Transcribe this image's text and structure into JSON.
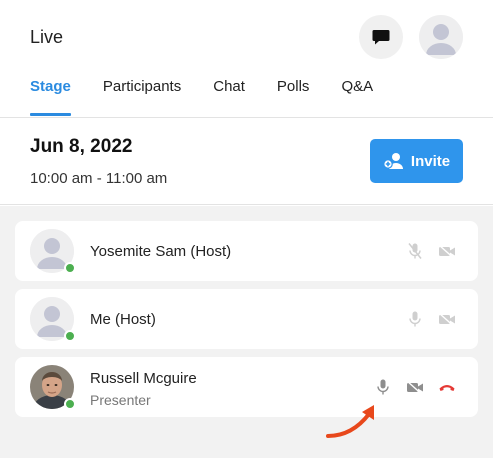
{
  "header": {
    "title": "Live"
  },
  "tabs": [
    {
      "label": "Stage",
      "active": true
    },
    {
      "label": "Participants",
      "active": false
    },
    {
      "label": "Chat",
      "active": false
    },
    {
      "label": "Polls",
      "active": false
    },
    {
      "label": "Q&A",
      "active": false
    }
  ],
  "event": {
    "date": "Jun 8, 2022",
    "time": "10:00 am - 11:00 am",
    "invite_label": "Invite"
  },
  "participants": [
    {
      "name": "Yosemite Sam (Host)",
      "role": "",
      "mic": "muted",
      "video": "off",
      "status": "online"
    },
    {
      "name": "Me (Host)",
      "role": "",
      "mic": "on",
      "video": "off",
      "status": "online"
    },
    {
      "name": "Russell Mcguire",
      "role": "Presenter",
      "mic": "on",
      "video": "off",
      "status": "online"
    }
  ],
  "colors": {
    "accent": "#2b8be0",
    "invite_bg": "#2f95ec",
    "online": "#4caf50",
    "hangup": "#e53935",
    "annotation_arrow": "#e8481c"
  }
}
